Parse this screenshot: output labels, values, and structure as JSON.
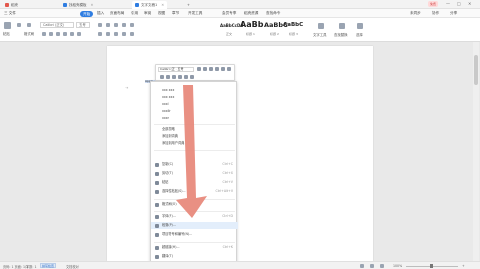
{
  "titlebar": {
    "tabs": [
      {
        "label": "稻壳",
        "color": "#e2574c"
      },
      {
        "label": "找稻壳模板",
        "color": "#2f7de1"
      },
      {
        "label": "文字文稿1",
        "color": "#2f7de1"
      }
    ],
    "user_label": "免费",
    "window_controls": [
      "—",
      "□",
      "✕"
    ]
  },
  "menubar": {
    "items": [
      "三 文件",
      "开始",
      "插入",
      "页面布局",
      "引用",
      "审阅",
      "视图",
      "章节",
      "开发工具",
      "会员专享",
      "稻壳资源",
      "查找命令"
    ],
    "active_index": 1,
    "right_items": [
      "未同步",
      "协作",
      "分享"
    ]
  },
  "ribbon": {
    "paste_label": "粘贴",
    "format_painter_label": "格式刷",
    "font_name": "Calibri (正文)",
    "font_size": "五号",
    "styles": [
      {
        "sample": "AaBbCcDd",
        "caption": "正文"
      },
      {
        "sample": "AaBb",
        "caption": "标题 1"
      },
      {
        "sample": "AaBbC",
        "caption": "标题 2"
      },
      {
        "sample": "AaBbC",
        "caption": "标题 3"
      }
    ],
    "text_tools_label": "文字工具",
    "find_replace_label": "查找替换",
    "select_label": "选择"
  },
  "document": {
    "selected_text": "Appli"
  },
  "mini_toolbar": {
    "font_name": "Calibri (正 · 五号"
  },
  "context_menu": {
    "word_suggestions": [
      "xxx xxx",
      "xxx xxx",
      "xxxl",
      "xxxllr",
      "xxxr"
    ],
    "top_items": [
      "全部忽略",
      "添加到词典",
      "添加到用户词典"
    ],
    "items": [
      {
        "label": "复制(C)",
        "shortcut": "Ctrl+C"
      },
      {
        "label": "剪切(T)",
        "shortcut": "Ctrl+X"
      },
      {
        "label": "粘贴",
        "shortcut": "Ctrl+V"
      },
      {
        "label": "选择性粘贴(S)...",
        "shortcut": "Ctrl+Alt+V"
      },
      {
        "label": "格式刷(O)",
        "shortcut": ""
      },
      {
        "label": "字体(F)...",
        "shortcut": "Ctrl+D"
      },
      {
        "label": "段落(P)...",
        "shortcut": ""
      },
      {
        "label": "项目符号和编号(N)...",
        "shortcut": ""
      },
      {
        "label": "超链接(H)...",
        "shortcut": "Ctrl+K"
      },
      {
        "label": "翻译(T)",
        "shortcut": ""
      }
    ],
    "highlighted_index": 6
  },
  "statusbar": {
    "page_info": "页码: 1  页面: 1/1",
    "word_count": "字数: 1",
    "spell_check": "拼写检查",
    "doc_check": "文档校对",
    "zoom": "100%"
  },
  "colors": {
    "accent": "#2f7de1",
    "arrow": "#e88a7c"
  }
}
